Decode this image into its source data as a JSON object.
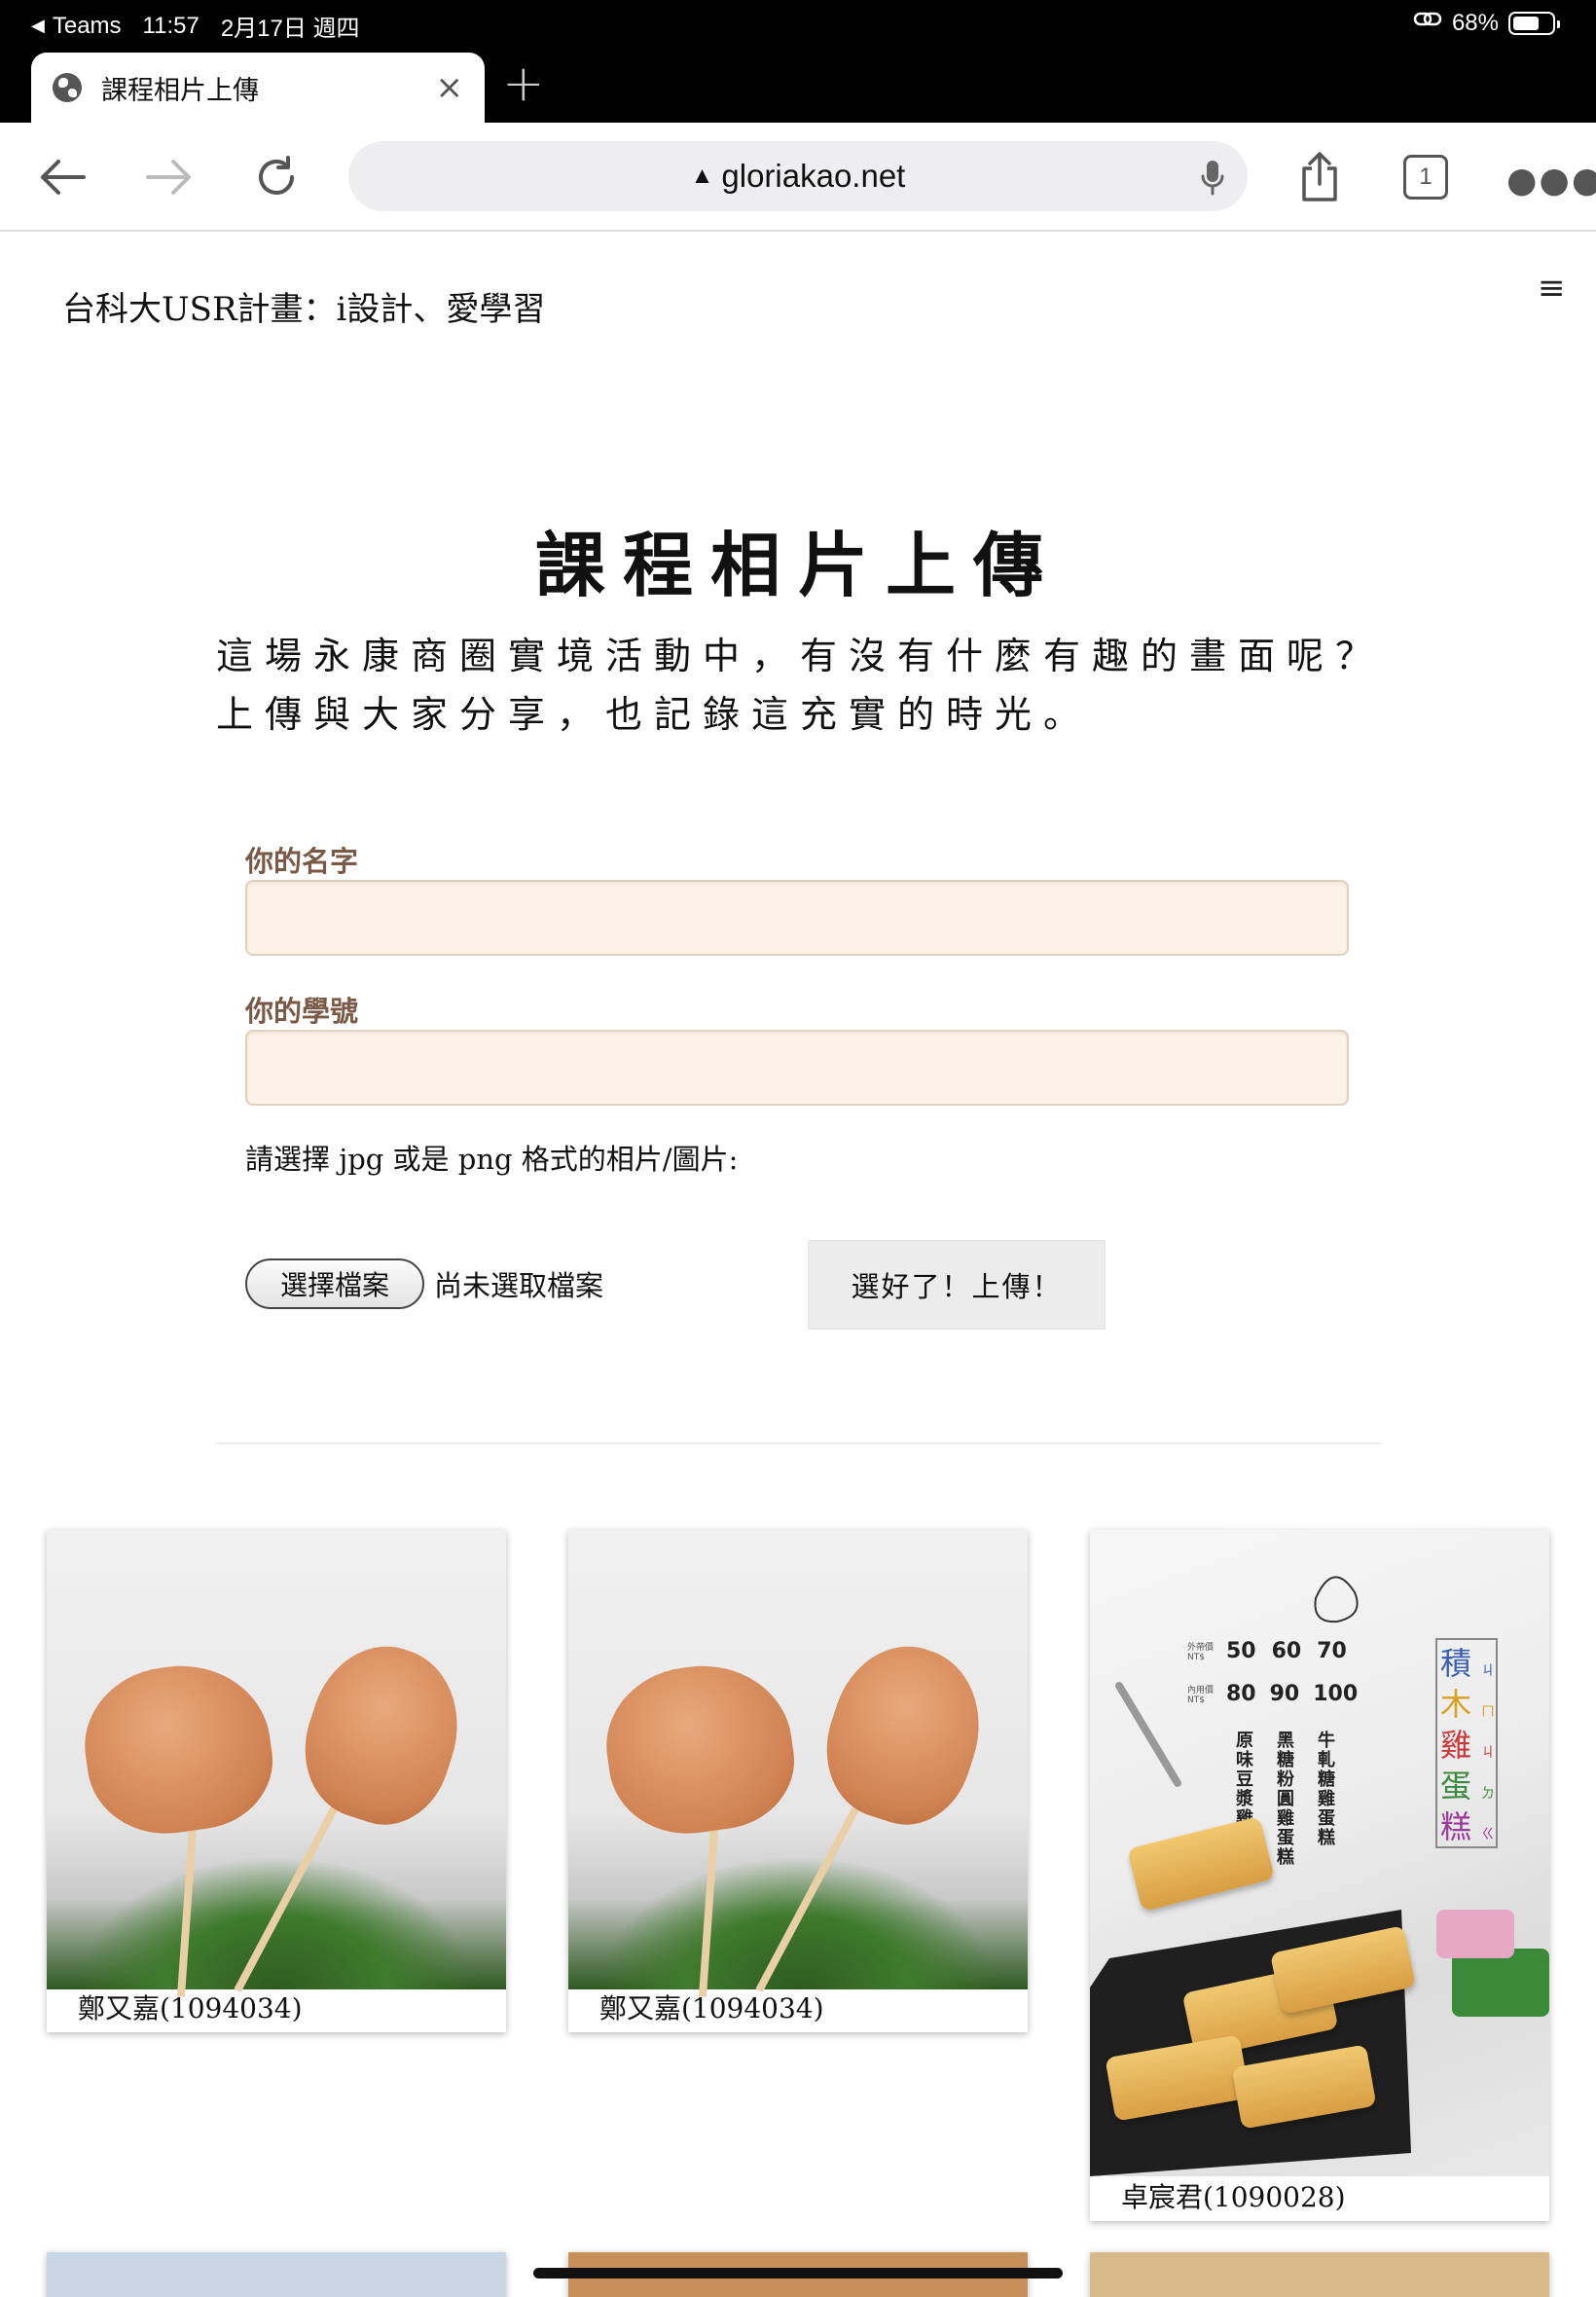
{
  "status_bar": {
    "back_app": "Teams",
    "time": "11:57",
    "date": "2月17日 週四",
    "battery": "68%",
    "battery_level": 0.68
  },
  "browser": {
    "tab_title": "課程相片上傳",
    "url": "gloriakao.net",
    "tab_count": "1"
  },
  "site": {
    "title": "台科大USR計畫：i設計、愛學習"
  },
  "page": {
    "heading": "課程相片上傳",
    "intro_line1": "這場永康商圈實境活動中，有沒有什麼有趣的畫面呢？",
    "intro_line2": "上傳與大家分享，也記錄這充實的時光。"
  },
  "form": {
    "name_label": "你的名字",
    "name_value": "",
    "id_label": "你的學號",
    "id_value": "",
    "file_hint": "請選擇 jpg 或是 png 格式的相片/圖片:",
    "choose_button": "選擇檔案",
    "file_status": "尚未選取檔案",
    "submit_button": "選好了！上傳！"
  },
  "gallery": [
    {
      "caption": "鄭又嘉(1094034)"
    },
    {
      "caption": "鄭又嘉(1094034)"
    },
    {
      "caption": "卓宸君(1090028)"
    }
  ],
  "poster": {
    "price_label_out": "外帶價",
    "price_label_in": "內用價",
    "currency": "NT$",
    "prices_out": [
      "50",
      "60",
      "70"
    ],
    "prices_in": [
      "80",
      "90",
      "100"
    ],
    "flavors": [
      "原味豆漿雞蛋糕",
      "黑糖粉圓雞蛋糕",
      "牛軋糖雞蛋糕"
    ],
    "brand_chars": [
      "積",
      "木",
      "雞",
      "蛋",
      "糕"
    ],
    "brand_zhuyin": [
      "ㄐ",
      "ㄇ",
      "ㄐ",
      "ㄉ",
      "ㄍ"
    ]
  },
  "colors": {
    "label_brown": "#7a5a46",
    "input_bg": "#fcf3e6"
  }
}
